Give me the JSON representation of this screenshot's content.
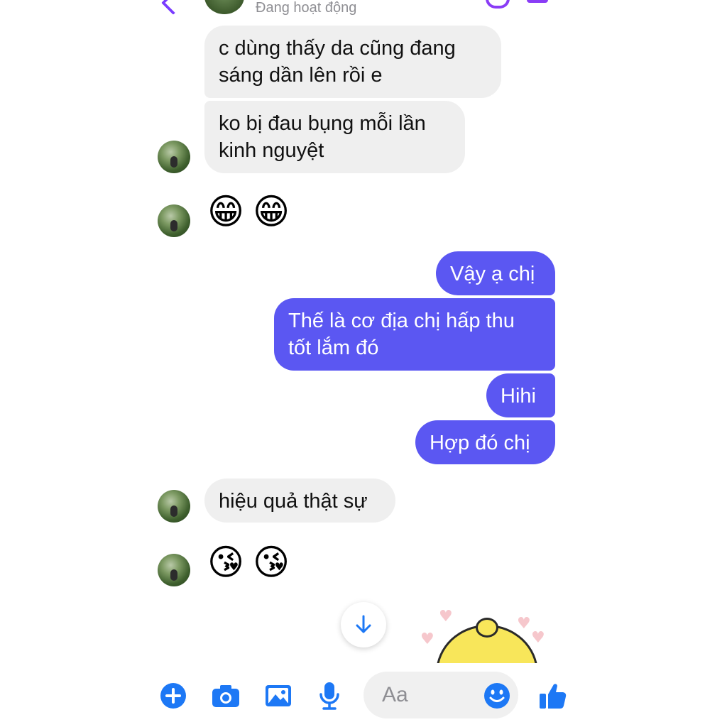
{
  "header": {
    "status": "Đang hoạt động"
  },
  "messages": {
    "m1": "c dùng thấy da cũng đang sáng dần lên rồi e",
    "m2": "ko bị đau bụng mỗi lần kinh nguyệt",
    "m3": "😁",
    "m4": "😁",
    "m5": "Vậy ạ chị",
    "m6": "Thế là cơ địa chị hấp thu tốt lắm đó",
    "m7": "Hihi",
    "m8": "Hợp đó chị",
    "m9": "hiệu quả thật sự",
    "m10": "😘",
    "m11": "😘"
  },
  "composer": {
    "placeholder": "Aa"
  },
  "icons": [
    "back-icon",
    "phone-icon",
    "video-icon",
    "scroll-down-icon",
    "plus-icon",
    "camera-icon",
    "image-icon",
    "microphone-icon",
    "smiley-icon",
    "thumbs-up-icon"
  ],
  "colors": {
    "accent": "#1d78f5",
    "outgoing_bubble": "#5b57f2",
    "incoming_bubble": "#efefef"
  }
}
